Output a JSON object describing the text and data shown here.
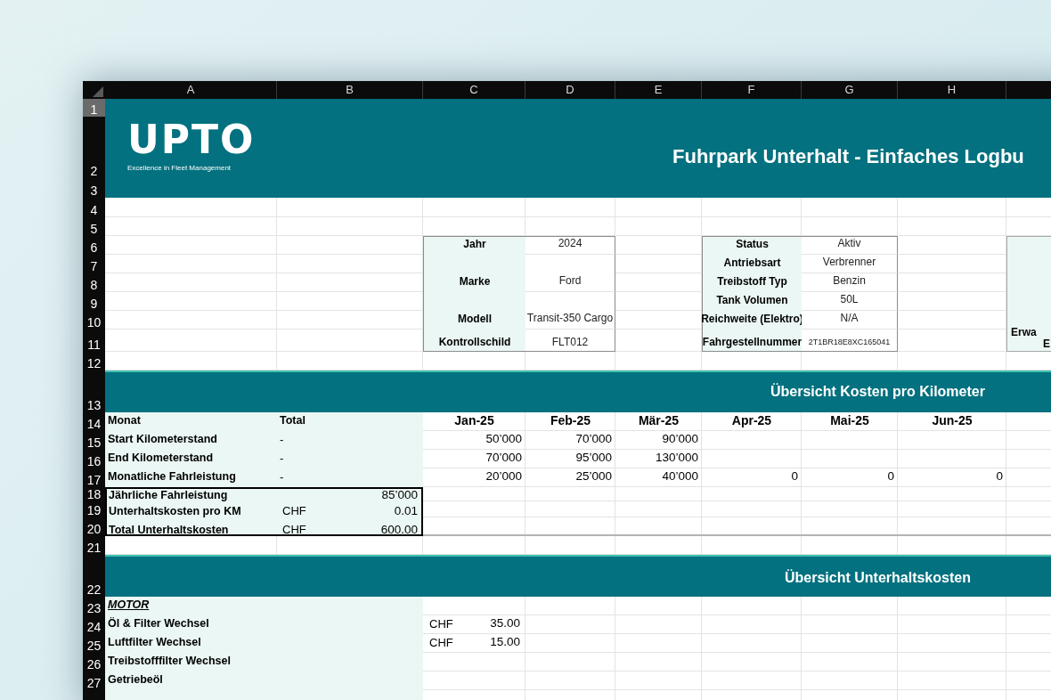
{
  "columns": [
    {
      "label": "A",
      "selected": false
    },
    {
      "label": "B",
      "selected": false
    },
    {
      "label": "C",
      "selected": false
    },
    {
      "label": "D",
      "selected": false
    },
    {
      "label": "E",
      "selected": false
    },
    {
      "label": "F",
      "selected": false
    },
    {
      "label": "G",
      "selected": false
    },
    {
      "label": "H",
      "selected": false
    }
  ],
  "row_headers": [
    {
      "label": "1",
      "selected": true
    },
    {
      "label": "2",
      "selected": false
    },
    {
      "label": "3",
      "selected": false
    },
    {
      "label": "4",
      "selected": false
    },
    {
      "label": "5",
      "selected": false
    },
    {
      "label": "6",
      "selected": false
    },
    {
      "label": "7",
      "selected": false
    },
    {
      "label": "8",
      "selected": false
    },
    {
      "label": "9",
      "selected": false
    },
    {
      "label": "10",
      "selected": false
    },
    {
      "label": "11",
      "selected": false
    },
    {
      "label": "12",
      "selected": false
    },
    {
      "label": "13",
      "selected": false
    },
    {
      "label": "14",
      "selected": false
    },
    {
      "label": "15",
      "selected": false
    },
    {
      "label": "16",
      "selected": false
    },
    {
      "label": "17",
      "selected": false
    },
    {
      "label": "18",
      "selected": false
    },
    {
      "label": "19",
      "selected": false
    },
    {
      "label": "20",
      "selected": false
    },
    {
      "label": "21",
      "selected": false
    },
    {
      "label": "22",
      "selected": false
    },
    {
      "label": "23",
      "selected": false
    },
    {
      "label": "24",
      "selected": false
    },
    {
      "label": "25",
      "selected": false
    },
    {
      "label": "26",
      "selected": false
    },
    {
      "label": "27",
      "selected": false
    }
  ],
  "header": {
    "logo": "UPTO",
    "tagline": "Excellence in Fleet Management",
    "title": "Fuhrpark Unterhalt - Einfaches Logbu"
  },
  "vehicle_box": [
    {
      "label": "Jahr",
      "value": "2024"
    },
    {
      "label": "Marke",
      "value": "Ford"
    },
    {
      "label": "Modell",
      "value": "Transit-350 Cargo"
    },
    {
      "label": "Kontrollschild",
      "value": "FLT012"
    }
  ],
  "status_box": [
    {
      "label": "Status",
      "value": "Aktiv"
    },
    {
      "label": "Antriebsart",
      "value": "Verbrenner"
    },
    {
      "label": "Treibstoff Typ",
      "value": "Benzin"
    },
    {
      "label": "Tank Volumen",
      "value": "50L"
    },
    {
      "label": "Reichweite (Elektro)",
      "value": "N/A"
    },
    {
      "label": "Fahrgestellnummer",
      "value": "2T1BR18E8XC165041"
    }
  ],
  "third_box": {
    "line_1": "Erwa",
    "line_2": "E"
  },
  "km_section": {
    "title": "Übersicht Kosten pro Kilometer",
    "header": {
      "label": "Monat",
      "total": "Total",
      "months": [
        "Jan-25",
        "Feb-25",
        "Mär-25",
        "Apr-25",
        "Mai-25",
        "Jun-25"
      ]
    },
    "rows": [
      {
        "label": "Start Kilometerstand",
        "total": "-",
        "values": [
          "50’000",
          "70’000",
          "90’000"
        ]
      },
      {
        "label": "End Kilometerstand",
        "total": "-",
        "values": [
          "70’000",
          "95’000",
          "130’000"
        ]
      },
      {
        "label": "Monatliche Fahrleistung",
        "total": "-",
        "values": [
          "20’000",
          "25’000",
          "40’000",
          "0",
          "0",
          "0"
        ]
      }
    ],
    "summary": [
      {
        "label": "Jährliche Fahrleistung",
        "value": "85’000"
      },
      {
        "label": "Unterhaltskosten pro KM",
        "currency": "CHF",
        "value": "0.01"
      },
      {
        "label": "Total Unterhaltskosten",
        "currency": "CHF",
        "value": "600.00"
      }
    ]
  },
  "cost_section": {
    "title": "Übersicht Unterhaltskosten",
    "rows": [
      {
        "kind": "category",
        "label": "MOTOR"
      },
      {
        "kind": "item",
        "label": "Öl & Filter Wechsel",
        "currency": "CHF",
        "amount": "35.00"
      },
      {
        "kind": "item",
        "label": "Luftfilter Wechsel",
        "currency": "CHF",
        "amount": "15.00"
      },
      {
        "kind": "item",
        "label": "Treibstofffilter Wechsel"
      },
      {
        "kind": "item",
        "label": "Getriebeöl"
      }
    ]
  }
}
